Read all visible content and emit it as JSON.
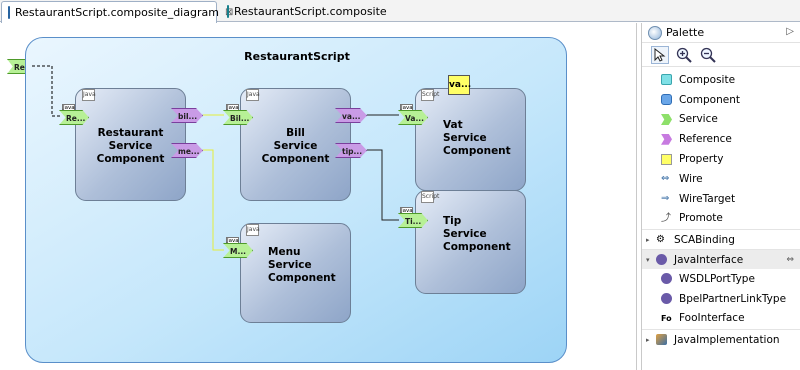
{
  "tabs": [
    {
      "label": "RestaurantScript.composite_diagram",
      "close": "⊠"
    },
    {
      "label": "RestaurantScript.composite"
    }
  ],
  "composite": {
    "title": "RestaurantScript",
    "service_label": "Re..."
  },
  "components": {
    "restaurant": {
      "lines": [
        "Restaurant",
        "Service",
        "Component"
      ],
      "impl": "Java",
      "service": "Re...",
      "refs": [
        "bil...",
        "me..."
      ]
    },
    "bill": {
      "lines": [
        "Bill",
        "Service",
        "Component"
      ],
      "impl": "Java",
      "service": "Bil...",
      "refs": [
        "va...",
        "tip..."
      ]
    },
    "vat": {
      "lines": [
        "Vat",
        "Service",
        "Component"
      ],
      "impl": "Script",
      "service": "Va...",
      "property": "va..."
    },
    "menu": {
      "lines": [
        "Menu",
        "Service",
        "Component"
      ],
      "impl": "Java",
      "service": "M..."
    },
    "tip": {
      "lines": [
        "Tip",
        "Service",
        "Component"
      ],
      "impl": "Script",
      "service": "Ti..."
    }
  },
  "palette": {
    "title": "Palette",
    "tools": [
      "select-tool",
      "zoom-in-tool",
      "zoom-out-tool"
    ],
    "items": [
      {
        "label": "Composite",
        "icon": "composite-icon",
        "color": "#7fe0e6"
      },
      {
        "label": "Component",
        "icon": "component-icon",
        "color": "#6aa6e8"
      },
      {
        "label": "Service",
        "icon": "service-icon",
        "color": "#8ee06a"
      },
      {
        "label": "Reference",
        "icon": "reference-icon",
        "color": "#c77be0"
      },
      {
        "label": "Property",
        "icon": "property-icon",
        "color": "#ffff66"
      },
      {
        "label": "Wire",
        "icon": "wire-icon"
      },
      {
        "label": "WireTarget",
        "icon": "wire-target-icon"
      },
      {
        "label": "Promote",
        "icon": "promote-icon"
      }
    ],
    "drawers": {
      "sca_binding": "SCABinding",
      "java_interface": "JavaInterface",
      "java_interface_items": [
        "WSDLPortType",
        "BpelPartnerLinkType",
        "FooInterface"
      ],
      "java_implementation": "JavaImplementation"
    }
  }
}
